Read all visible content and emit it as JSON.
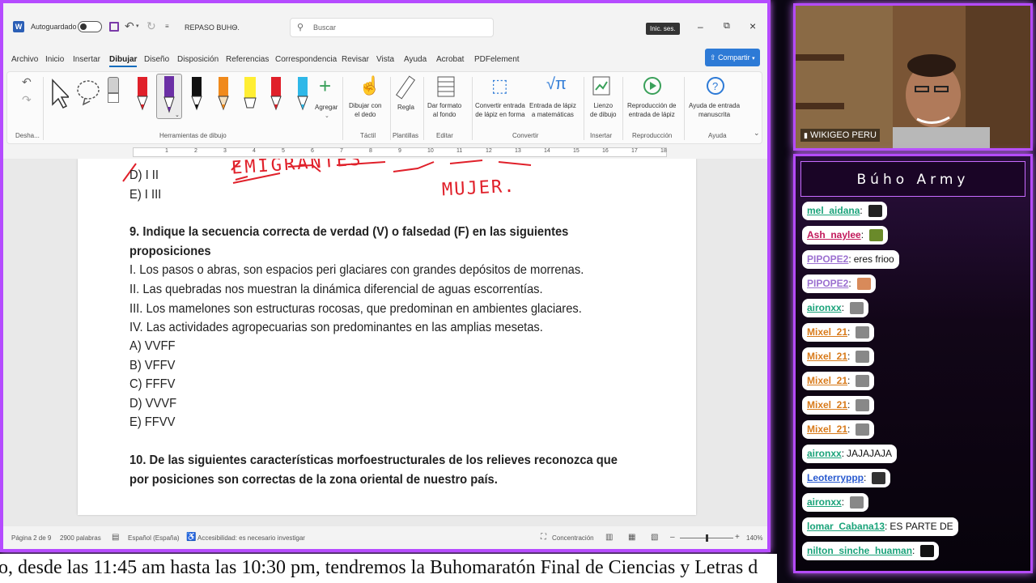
{
  "titlebar": {
    "autosave_label": "Autoguardado",
    "doc_title": "REPASO BUHO.",
    "search_placeholder": "Buscar",
    "signin_label": "Inic. ses."
  },
  "menu": [
    "Archivo",
    "Inicio",
    "Insertar",
    "Dibujar",
    "Diseño",
    "Disposición",
    "Referencias",
    "Correspondencia",
    "Revisar",
    "Vista",
    "Ayuda",
    "Acrobat",
    "PDFelement"
  ],
  "share_label": "Compartir",
  "ribbon": {
    "undo_label": "Desha...",
    "drawing_tools_group": "Herramientas de dibujo",
    "add_label": "Agregar",
    "draw_finger_label": "Dibujar con\nel dedo",
    "touch_group": "Táctil",
    "ruler_label": "Regla",
    "templates_group": "Plantillas",
    "bg_format_label": "Dar formato\nal fondo",
    "edit_group": "Editar",
    "ink_to_shape_label": "Convertir entrada\nde lápiz en forma",
    "ink_to_math_label": "Entrada de lápiz\na matemáticas",
    "convert_group": "Convertir",
    "canvas_label": "Lienzo\nde dibujo",
    "insert_group": "Insertar",
    "replay_label": "Reproducción de\nentrada de lápiz",
    "replay_group": "Reproducción",
    "help_label": "Ayuda de entrada\nmanuscrita",
    "help_group": "Ayuda"
  },
  "document": {
    "option_d_prev": "D) I II",
    "option_e_prev": "E) I III",
    "handwriting_1": "EMIGRANTES",
    "handwriting_2": "MUJER.",
    "q9_title_1": "9. Indique la secuencia correcta de verdad (V) o falsedad (F) en las siguientes",
    "q9_title_2": "proposiciones",
    "q9_items": [
      "I. Los pasos o abras, son espacios peri glaciares con grandes depósitos de morrenas.",
      "II. Las quebradas nos muestran la dinámica diferencial de aguas escorrentías.",
      "III. Los mamelones son estructuras rocosas, que predominan en ambientes glaciares.",
      "IV. Las actividades agropecuarias son predominantes en las amplias mesetas."
    ],
    "q9_options": [
      "A) VVFF",
      "B) VFFV",
      "C) FFFV",
      "D) VVVF",
      "E) FFVV"
    ],
    "q10_title_1": "10. De las siguientes características morfoestructurales de los relieves reconozca que",
    "q10_title_2": "por posiciones son correctas de la zona oriental de nuestro país."
  },
  "status": {
    "page": "Página 2 de 9",
    "words": "2900 palabras",
    "language": "Español (España)",
    "accessibility": "Accesibilidad: es necesario investigar",
    "focus": "Concentración",
    "zoom": "140%"
  },
  "webcam": {
    "name_tag": "WIKIGEO PERU"
  },
  "chat": {
    "header": "Búho Army",
    "messages": [
      {
        "user": "mel_aidana",
        "text": "",
        "color": "#1aa37a",
        "emote": "#222"
      },
      {
        "user": "Ash_naylee",
        "text": "",
        "color": "#c2185b",
        "emote": "#6a8a2a"
      },
      {
        "user": "PIPOPE2",
        "text": "eres frioo",
        "color": "#9b6fd0",
        "emote": ""
      },
      {
        "user": "PIPOPE2",
        "text": "",
        "color": "#9b6fd0",
        "emote": "#d88a5a"
      },
      {
        "user": "aironxx",
        "text": "",
        "color": "#1aa37a",
        "emote": "#888"
      },
      {
        "user": "Mixel_21",
        "text": "",
        "color": "#d87a1a",
        "emote": "#888"
      },
      {
        "user": "Mixel_21",
        "text": "",
        "color": "#d87a1a",
        "emote": "#888"
      },
      {
        "user": "Mixel_21",
        "text": "",
        "color": "#d87a1a",
        "emote": "#888"
      },
      {
        "user": "Mixel_21",
        "text": "",
        "color": "#d87a1a",
        "emote": "#888"
      },
      {
        "user": "Mixel_21",
        "text": "",
        "color": "#d87a1a",
        "emote": "#888"
      },
      {
        "user": "aironxx",
        "text": "JAJAJAJA",
        "color": "#1aa37a",
        "emote": ""
      },
      {
        "user": "Leoterryppp",
        "text": "",
        "color": "#2a5bd0",
        "emote": "#333"
      },
      {
        "user": "aironxx",
        "text": "",
        "color": "#1aa37a",
        "emote": "#888"
      },
      {
        "user": "lomar_Cabana13",
        "text": "ES PARTE DE",
        "color": "#1aa37a",
        "emote": ""
      },
      {
        "user": "nilton_sinche_huaman",
        "text": "",
        "color": "#1aa37a",
        "emote": "#111"
      }
    ]
  },
  "ticker": {
    "text": "o, desde las 11:45 am hasta las 10:30 pm, tendremos la Buhomaratón Final de Ciencias y Letras d"
  },
  "colors": {
    "frame_neon": "#b54bff",
    "word_accent": "#0f6cbd",
    "ink_red": "#e0202a"
  }
}
